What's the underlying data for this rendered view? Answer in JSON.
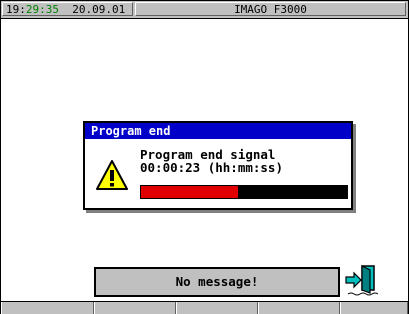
{
  "statusbar": {
    "time_prefix": "19:",
    "time_mid": "29",
    "time_sep": ":",
    "time_sec": "35",
    "date": "20.09.01",
    "title": "IMAGO F3000"
  },
  "dialog": {
    "title": "Program end",
    "line1": "Program end signal",
    "line2": "00:00:23 (hh:mm:ss)",
    "progress_fraction": 0.47,
    "progress_color": "#e00000",
    "icon": "warning-icon"
  },
  "message": {
    "text": "No message!"
  },
  "exit": {
    "icon": "exit-door-icon"
  },
  "softkeys": {
    "count": 5
  },
  "colors": {
    "title_bar": "#0000c8",
    "panel": "#c0c0c0",
    "time_highlight": "#008000"
  }
}
